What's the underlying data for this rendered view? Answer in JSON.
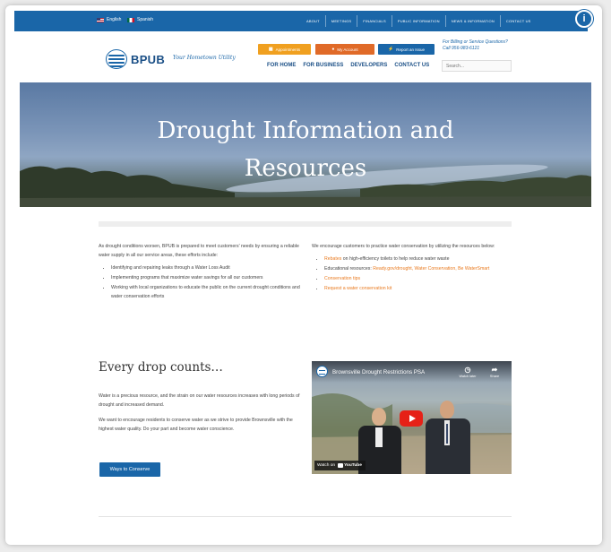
{
  "topbar": {
    "lang_english": "English",
    "lang_spanish": "Spanish",
    "nav": [
      "ABOUT",
      "MEETINGS",
      "FINANCIALS",
      "PUBLIC INFORMATION",
      "NEWS & INFORMATION",
      "CONTACT US"
    ],
    "accessibility_label": "i"
  },
  "header": {
    "logo_text": "BPUB",
    "tagline": "Your Hometown Utility",
    "quick_buttons": [
      {
        "label": "Appointments",
        "icon": "calendar-icon",
        "color": "#f0a020"
      },
      {
        "label": "My Account",
        "icon": "user-icon",
        "color": "#e06a28"
      },
      {
        "label": "Report an Issue",
        "icon": "bolt-icon",
        "color": "#1a66a8"
      }
    ],
    "contact_line1": "For Billing or Service Questions?",
    "contact_line2": "Call 956-983-6121",
    "nav": [
      "FOR HOME",
      "FOR BUSINESS",
      "DEVELOPERS",
      "CONTACT US"
    ],
    "search_placeholder": "Search..."
  },
  "hero": {
    "title_line1": "Drought Information and",
    "title_line2": "Resources"
  },
  "left_col": {
    "intro": "As drought conditions worsen, BPUB is prepared to meet customers' needs by ensuring a reliable water supply in all our service areas, these efforts include:",
    "items": [
      "Identifying and repairing leaks through a Water Loss Audit",
      "Implementing programs that maximize water savings for all our customers",
      "Working with local organizations to educate the public on the current drought conditions and water conservation efforts"
    ]
  },
  "right_col": {
    "intro": "We encourage customers to practice water conservation by utilizing the resources below:",
    "item1_link": "Rebates",
    "item1_text": " on high-efficiency toilets to help reduce water waste",
    "item2_text": "Educational resources: ",
    "item2_links": "Ready.gov/drought, Water Conservation, Be WaterSmart",
    "item3_link": "Conservation tips",
    "item4_link": "Request a water conservation kit"
  },
  "drop": {
    "title": "Every drop counts…",
    "p1": "Water is a precious resource, and the strain on our water resources increases with long periods of drought and increased demand.",
    "p2": "We want to encourage residents to conserve water as we strive to provide Brownsville with the highest water quality. Do your part and become water conscience.",
    "button": "Ways to Conserve"
  },
  "video": {
    "title": "Brownsville Drought Restrictions PSA",
    "watch_later": "Watch later",
    "share": "Share",
    "watch_on": "Watch on",
    "youtube": "YouTube"
  },
  "colors": {
    "primary": "#1a66a8",
    "accent_orange": "#e97a1f"
  }
}
